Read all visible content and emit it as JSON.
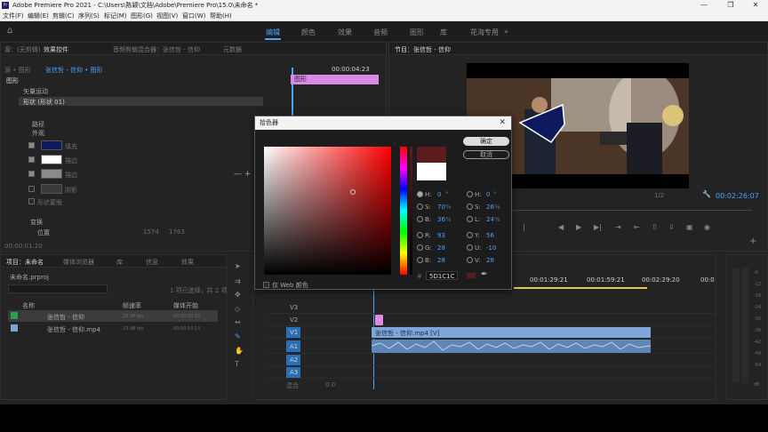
{
  "window": {
    "title": "Adobe Premiere Pro 2021 - C:\\Users\\陈颖\\文档\\Adobe\\Premiere Pro\\15.0\\未命名 *",
    "controls": [
      "—",
      "❐",
      "✕"
    ]
  },
  "menu": [
    "文件(F)",
    "编辑(E)",
    "剪辑(C)",
    "序列(S)",
    "标记(M)",
    "图形(G)",
    "视图(V)",
    "窗口(W)",
    "帮助(H)"
  ],
  "workspaces": {
    "items": [
      "编辑",
      "颜色",
      "效果",
      "音频",
      "图形",
      "库",
      "花海专用"
    ],
    "active": "编辑",
    "more": "»"
  },
  "effect_controls": {
    "tabs": [
      "源：(无剪辑)",
      "效果控件",
      "音频剪辑混合器：张信哲 - 信仰",
      "元数据"
    ],
    "master": "源 • 图形",
    "sequence": "张信哲 - 信仰 • 图形",
    "timecode": "00:00:04:23",
    "clip_label": "图形",
    "section": "图形",
    "vector_motion": "矢量运动",
    "shape": "形状 (形状 01)",
    "path": "路径",
    "appearance": "外观",
    "fill": "填充",
    "stroke1": "描边",
    "stroke2": "描边",
    "shadow": "阴影",
    "mask": "形状蒙版",
    "transform": "变换",
    "position": "位置",
    "position_x": "1574",
    "position_y": "1763",
    "bottom_time": "00:00:01:20",
    "fill_color": "#0e1a5e",
    "stroke1_color": "#ffffff",
    "stroke2_color": "#8a8a8a",
    "shadow_color": "#3a3a3a"
  },
  "program": {
    "tab": "节目：张信哲 - 信仰",
    "fraction": "1/2",
    "timecode": "00:02:26:07"
  },
  "project": {
    "tabs": [
      "项目：未命名",
      "媒体浏览器",
      "库",
      "信息",
      "效果"
    ],
    "file": "未命名.prproj",
    "selection": "1 项已选择，共 2 项",
    "columns": [
      "名称",
      "帧速率",
      "媒体开始"
    ],
    "items": [
      {
        "name": "张信哲 - 信仰",
        "fps": "23.98 fps",
        "start": "00:00:00:00",
        "color": "#2e9e4e"
      },
      {
        "name": "张信哲 - 信仰.mp4",
        "fps": "23.98 fps",
        "start": "00:00:10:15",
        "color": "#7aa6d6"
      }
    ]
  },
  "timeline": {
    "ruler": [
      "00:01:29:21",
      "00:01:59:21",
      "00:02:29:20",
      "00:0"
    ],
    "video_tracks": [
      "V3",
      "V2",
      "V1"
    ],
    "audio_tracks": [
      "A1",
      "A2",
      "A3"
    ],
    "master": "混合",
    "master_value": "0.0",
    "clip_v1": "张信哲 - 信仰.mp4 [V]",
    "v1_color": "#7fa6d9",
    "graphic_color": "#e08ae6"
  },
  "meter": {
    "labels": [
      "-6",
      "-12",
      "-18",
      "-24",
      "-30",
      "-36",
      "-42",
      "-48",
      "-54"
    ],
    "bottom": "dB"
  },
  "color_picker": {
    "title": "拾色器",
    "ok": "确定",
    "cancel": "取消",
    "web_only": "仅 Web 颜色",
    "hex": "5D1C1C",
    "new_color": "#5d1c1c",
    "old_color": "#ffffff",
    "left_fields": [
      {
        "label": "H:",
        "value": "0",
        "unit": "°"
      },
      {
        "label": "S:",
        "value": "70",
        "unit": "%"
      },
      {
        "label": "B:",
        "value": "36",
        "unit": "%"
      },
      {
        "label": "R:",
        "value": "93",
        "unit": ""
      },
      {
        "label": "G:",
        "value": "28",
        "unit": ""
      },
      {
        "label": "B:",
        "value": "28",
        "unit": ""
      }
    ],
    "right_fields": [
      {
        "label": "H:",
        "value": "0",
        "unit": "°"
      },
      {
        "label": "S:",
        "value": "26",
        "unit": "%"
      },
      {
        "label": "L:",
        "value": "24",
        "unit": "%"
      },
      {
        "label": "Y:",
        "value": "56",
        "unit": ""
      },
      {
        "label": "U:",
        "value": "-10",
        "unit": ""
      },
      {
        "label": "V:",
        "value": "28",
        "unit": ""
      }
    ]
  }
}
